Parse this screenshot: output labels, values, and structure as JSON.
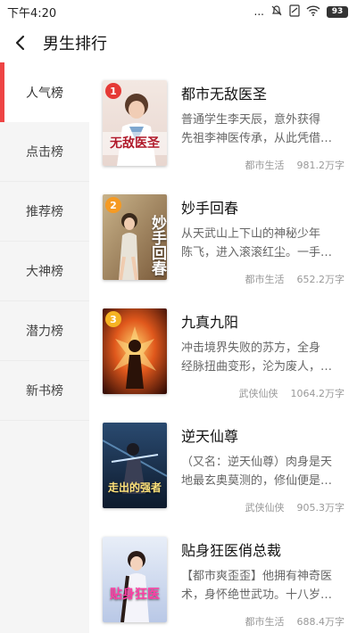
{
  "status_bar": {
    "time": "下午4:20",
    "signal_text": "...",
    "battery": "93"
  },
  "header": {
    "title": "男生排行"
  },
  "sidebar": {
    "items": [
      {
        "label": "人气榜",
        "active": true
      },
      {
        "label": "点击榜",
        "active": false
      },
      {
        "label": "推荐榜",
        "active": false
      },
      {
        "label": "大神榜",
        "active": false
      },
      {
        "label": "潜力榜",
        "active": false
      },
      {
        "label": "新书榜",
        "active": false
      }
    ]
  },
  "colors": {
    "accent": "#ee4444",
    "rank1": "#e53935",
    "rank2": "#f59a23",
    "rank3": "#f5b323"
  },
  "books": [
    {
      "rank": "1",
      "title": "都市无敌医圣",
      "cover_text": "无敌医圣",
      "desc_line1": "普通学生李天辰，意外获得",
      "desc_line2": "先祖李神医传承，从此凭借…",
      "category": "都市生活",
      "words": "981.2万字"
    },
    {
      "rank": "2",
      "title": "妙手回春",
      "cover_text": "妙手回春",
      "desc_line1": "从天武山上下山的神秘少年",
      "desc_line2": "陈飞，进入滚滚红尘。一手…",
      "category": "都市生活",
      "words": "652.2万字"
    },
    {
      "rank": "3",
      "title": "九真九阳",
      "cover_text": "",
      "desc_line1": "冲击境界失败的苏方，全身",
      "desc_line2": "经脉扭曲变形，沦为废人，…",
      "category": "武侠仙侠",
      "words": "1064.2万字"
    },
    {
      "rank": "",
      "title": "逆天仙尊",
      "cover_text": "走出的强者",
      "desc_line1": "（又名：逆天仙尊）肉身是天",
      "desc_line2": "地最玄奥莫测的，修仙便是…",
      "category": "武侠仙侠",
      "words": "905.3万字"
    },
    {
      "rank": "",
      "title": "贴身狂医俏总裁",
      "cover_text": "贴身狂医",
      "desc_line1": "【都市爽歪歪】他拥有神奇医",
      "desc_line2": "术，身怀绝世武功。十八岁…",
      "category": "都市生活",
      "words": "688.4万字"
    }
  ]
}
